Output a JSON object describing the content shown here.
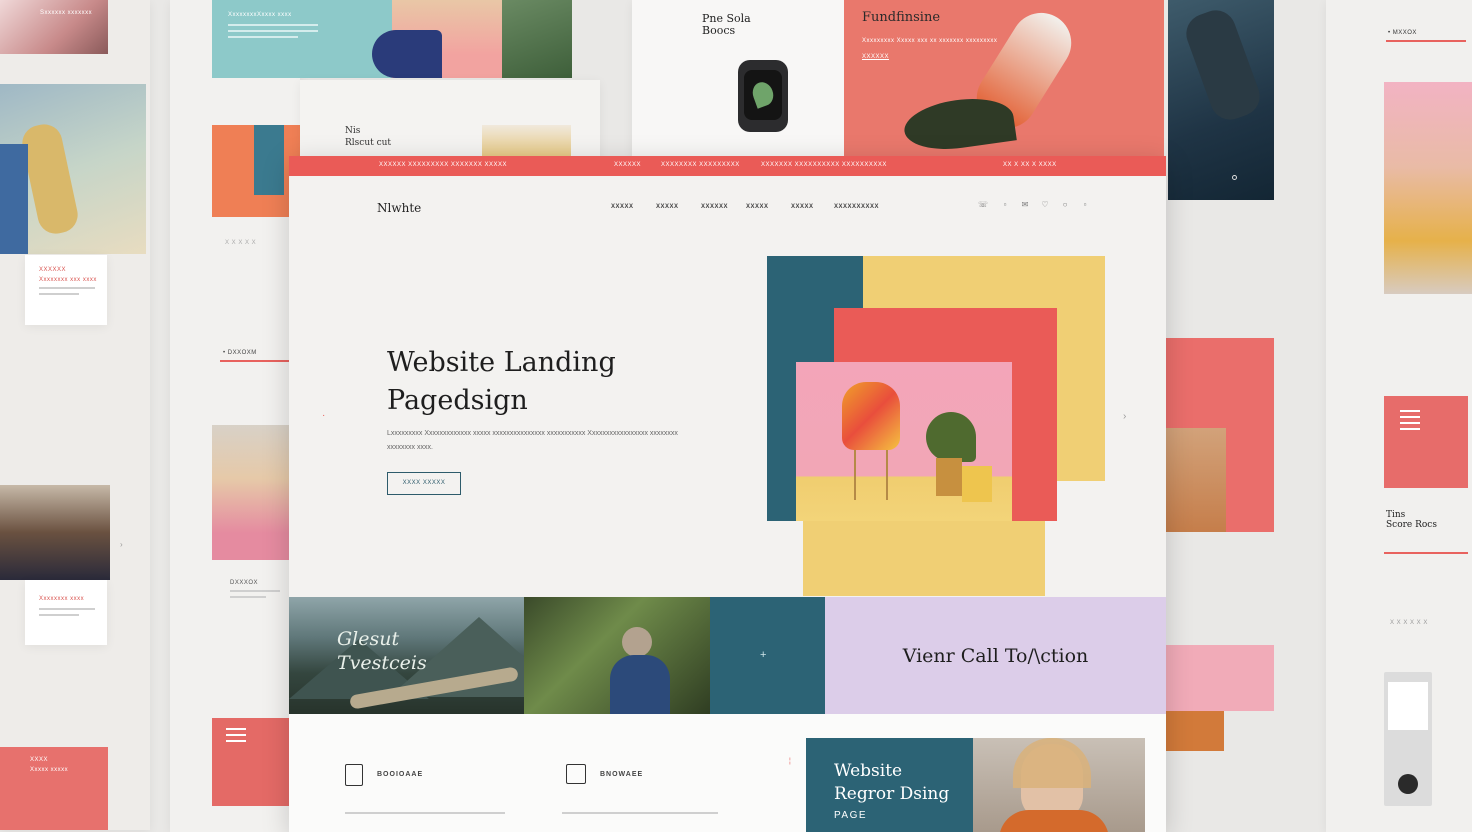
{
  "background": {
    "left_top_card": {
      "label": "Sxxxxxx xxxxxxx"
    },
    "left_card_a": {
      "label_red": "XXXXXX",
      "label_red2": "Xxxxxxxx xxx xxxx"
    },
    "left_card_b": {
      "label_red": "Xxxxxxxx xxxx"
    },
    "left_card_c": {
      "label_red": "XXXX",
      "label_red2": "Xxxxx xxxxx"
    },
    "left_section_label": "• DXXOXM",
    "left_small_caption": "DXXXOX",
    "top_left_card": {
      "caption": "XxxxxxxxXxxxx xxxx"
    },
    "top_small_card": {
      "title_line1": "Nis",
      "title_line2": "Rlscut cut"
    },
    "top_watch_card": {
      "title_line1": "Pne Sola",
      "title_line2": "Boocs"
    },
    "top_coral_card": {
      "title": "Fundfinsine",
      "text": "Xxxxxxxxx Xxxxx xxx xx xxxxxxx xxxxxxxxx",
      "link": "XXXXXX"
    },
    "right_card": {
      "section_label": "• MXXOX",
      "title_line1": "Tins",
      "title_line2": "Score Rocs",
      "caption": "X X X X X X"
    }
  },
  "main": {
    "topbar": {
      "left": "XXXXXX XXXXXXXXX XXXXXXX XXXXX",
      "center1": "XXXXXX",
      "center2": "XXXXXXXX XXXXXXXXX",
      "center3": "XXXXXXX XXXXXXXXXX XXXXXXXXXX",
      "right": "XX X XX X XXXX"
    },
    "nav": {
      "logo": "Nlwhte",
      "links": [
        "XXXXX",
        "XXXXX",
        "XXXXXX",
        "XXXXX",
        "XXXXX",
        "XXXXXXXXXX"
      ]
    },
    "hero": {
      "title_line1": "Website Landing",
      "title_line2": "Pagedsign",
      "text": "Lxxxxxxxxx Xxxxxxxxxxxxx xxxxx xxxxxxxxxxxxxxx xxxxxxxxxxx Xxxxxxxxxxxxxxxxx xxxxxxxx xxxxxxxx xxxx.",
      "button": "XXXX XXXXX"
    },
    "strip": {
      "mountain_text_line1": "Glesut",
      "mountain_text_line2": "Tvestceis",
      "cta": "Vienr Call To/\\ction"
    },
    "features": [
      {
        "label": "BOOIOAAE"
      },
      {
        "label": "BNOWAEE"
      }
    ],
    "promo": {
      "title_line1": "Website",
      "title_line2": "Regror Dsing",
      "sub": "PAGE"
    }
  },
  "colors": {
    "coral": "#ea5b57",
    "teal": "#2c6375",
    "yellow": "#f0cf74",
    "lavender": "#dccde9",
    "pink": "#f2a6b6"
  }
}
